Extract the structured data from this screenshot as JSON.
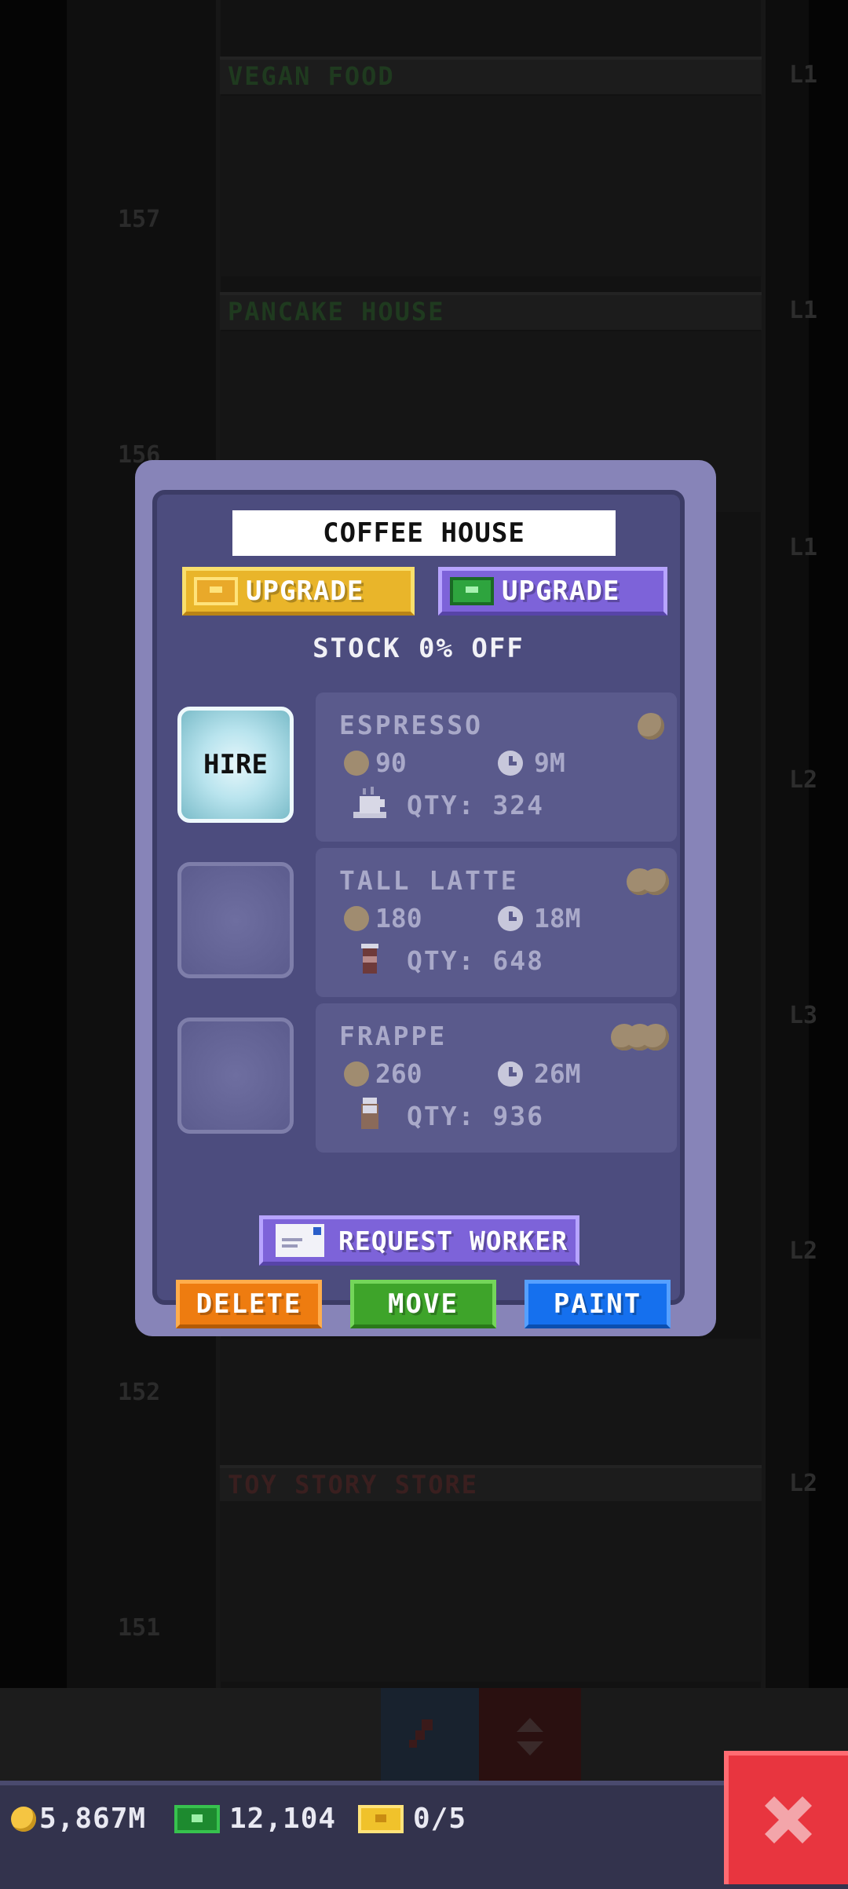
{
  "dialog": {
    "store_name": "COFFEE HOUSE",
    "upgrade_coins_label": "UPGRADE",
    "upgrade_bux_label": "UPGRADE",
    "stock_label": "STOCK 0% OFF",
    "hire_label": "HIRE",
    "request_worker_label": "REQUEST WORKER",
    "delete_label": "DELETE",
    "move_label": "MOVE",
    "paint_label": "PAINT",
    "products": [
      {
        "name": "ESPRESSO",
        "cost": "90",
        "time": "9M",
        "qty": "QTY: 324",
        "tier_coins": 1,
        "icon": "coffee-cup-icon"
      },
      {
        "name": "TALL LATTE",
        "cost": "180",
        "time": "18M",
        "qty": "QTY: 648",
        "tier_coins": 2,
        "icon": "latte-cup-icon"
      },
      {
        "name": "FRAPPE",
        "cost": "260",
        "time": "26M",
        "qty": "QTY: 936",
        "tier_coins": 3,
        "icon": "frappe-cup-icon"
      }
    ]
  },
  "background": {
    "floors": [
      {
        "name": "VEGAN FOOD",
        "level": "L1",
        "color": "#1f3a1f"
      },
      {
        "name": "PANCAKE HOUSE",
        "level": "L1",
        "color": "#1f3a1f"
      },
      {
        "name": "TOY STORY STORE",
        "level": "L2",
        "color": "#3a1f1f"
      }
    ],
    "floor_numbers": [
      "157",
      "156",
      "152",
      "151"
    ],
    "side_levels": [
      "L1",
      "L2",
      "L3",
      "L2",
      "L2"
    ]
  },
  "status": {
    "coins": "5,867M",
    "bux": "12,104",
    "tickets": "0/5"
  },
  "colors": {
    "dialog_bg": "#4c4c7e",
    "gold_button": "#e9b52a",
    "purple_button": "#7d63d9",
    "delete": "#ee7c10",
    "move": "#3ea42a",
    "paint": "#1570ee",
    "close": "#e8353f"
  }
}
